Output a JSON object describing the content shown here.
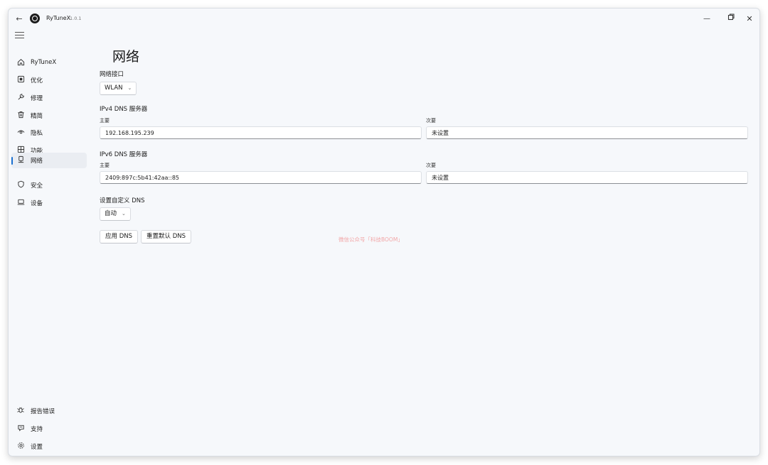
{
  "titlebar": {
    "app_name": "RyTuneX",
    "version": "1.0.1"
  },
  "nav": {
    "items": [
      {
        "label": "RyTuneX",
        "icon": "home-icon"
      },
      {
        "label": "优化",
        "icon": "optimize-icon"
      },
      {
        "label": "修理",
        "icon": "wrench-icon"
      },
      {
        "label": "精简",
        "icon": "trash-icon"
      },
      {
        "label": "隐私",
        "icon": "eye-icon"
      },
      {
        "label": "功能",
        "icon": "grid-icon"
      },
      {
        "label": "网络",
        "icon": "network-icon",
        "active": true
      },
      {
        "label": "安全",
        "icon": "shield-icon"
      },
      {
        "label": "设备",
        "icon": "laptop-icon"
      }
    ],
    "footer": [
      {
        "label": "报告错误",
        "icon": "bug-icon"
      },
      {
        "label": "支持",
        "icon": "support-icon"
      },
      {
        "label": "设置",
        "icon": "gear-icon"
      }
    ]
  },
  "page": {
    "title": "网络",
    "interface_label": "网络接口",
    "interface_value": "WLAN",
    "ipv4": {
      "heading": "IPv4 DNS 服务器",
      "primary_label": "主要",
      "primary_value": "192.168.195.239",
      "secondary_label": "次要",
      "secondary_value": "未设置"
    },
    "ipv6": {
      "heading": "IPv6 DNS 服务器",
      "primary_label": "主要",
      "primary_value": "2409:897c:5b41:42aa::85",
      "secondary_label": "次要",
      "secondary_value": "未设置"
    },
    "custom_dns_label": "设置自定义 DNS",
    "custom_dns_value": "自动",
    "apply_button": "应用 DNS",
    "reset_button": "重置默认 DNS"
  },
  "watermark": "微信公众号「科技BOOM」",
  "colors": {
    "accent": "#1a6fd0",
    "window_bg": "#f6f8fb",
    "nav_active_bg": "#eaedf2",
    "watermark": "#f08a8a"
  }
}
